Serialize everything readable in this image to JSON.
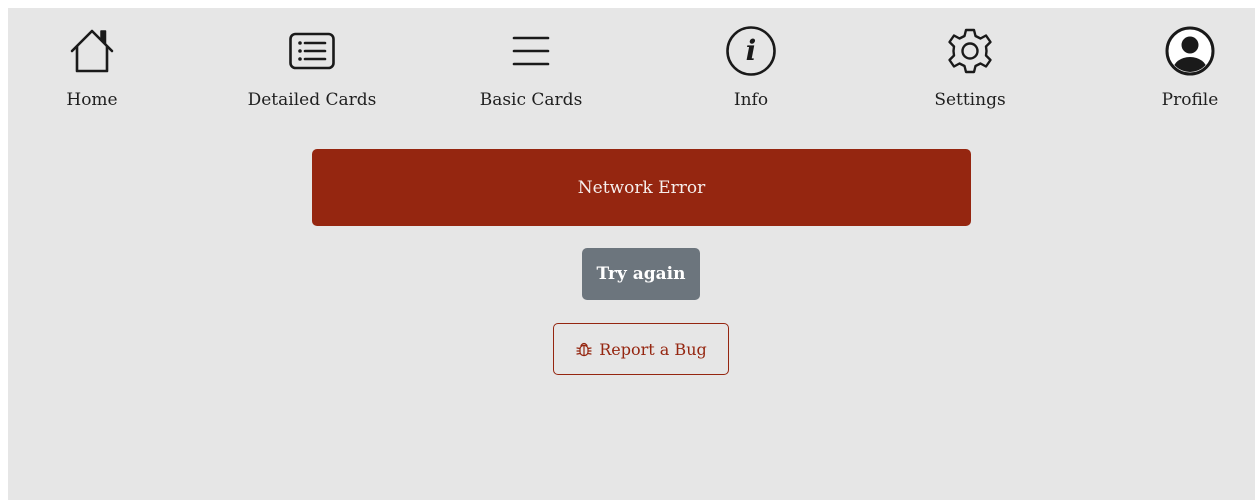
{
  "nav": {
    "items": [
      {
        "label": "Home",
        "icon": "home-icon"
      },
      {
        "label": "Detailed Cards",
        "icon": "list-box-icon"
      },
      {
        "label": "Basic Cards",
        "icon": "hamburger-icon"
      },
      {
        "label": "Info",
        "icon": "info-icon"
      },
      {
        "label": "Settings",
        "icon": "gear-icon"
      },
      {
        "label": "Profile",
        "icon": "user-circle-icon"
      }
    ]
  },
  "error": {
    "message": "Network Error"
  },
  "actions": {
    "try_again_label": "Try again",
    "report_bug_label": "Report a Bug",
    "report_bug_icon": "bug-icon"
  },
  "colors": {
    "background": "#e6e6e6",
    "error": "#952610",
    "secondary": "#6c757d",
    "text": "#1f1f1f"
  }
}
